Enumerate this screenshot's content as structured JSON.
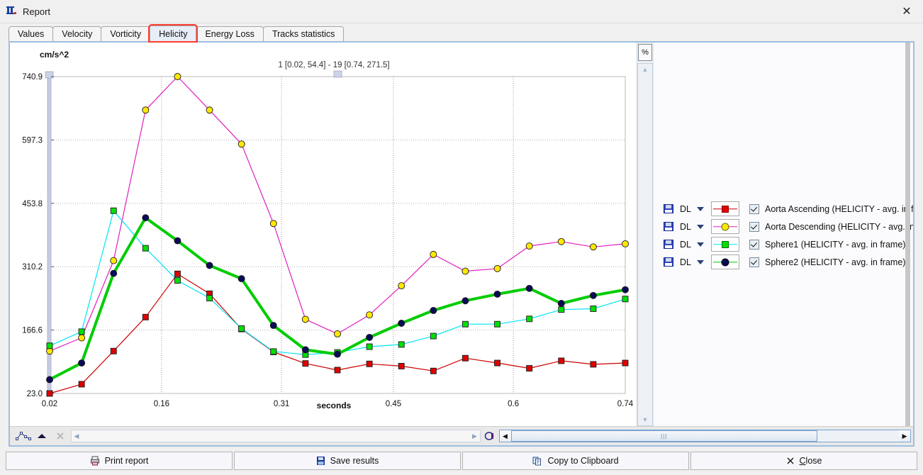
{
  "window": {
    "title": "Report",
    "icon": "report-chart-icon",
    "close_label": "✕"
  },
  "tabs": [
    {
      "label": "Values",
      "active": false,
      "highlight": false
    },
    {
      "label": "Velocity",
      "active": false,
      "highlight": false
    },
    {
      "label": "Vorticity",
      "active": false,
      "highlight": false
    },
    {
      "label": "Helicity",
      "active": true,
      "highlight": true
    },
    {
      "label": "Energy Loss",
      "active": false,
      "highlight": false
    },
    {
      "label": "Tracks statistics",
      "active": false,
      "highlight": false
    }
  ],
  "chart_panel": {
    "unit_label": "cm/s^2",
    "range_label": "1 [0.02, 54.4] - 19 [0.74, 271.5]",
    "percent_button": "%",
    "scroll_up": "▲",
    "scroll_down": "▼",
    "left_arrow": "◀",
    "right_arrow": "▶"
  },
  "toolbar": {
    "line_chart_icon": "line-chart-icon",
    "area_icon": "area-chart-icon",
    "delete_icon": "delete-icon",
    "camera_icon": "snapshot-icon"
  },
  "legend": {
    "dl_label": "DL",
    "items": [
      {
        "dl": "DL",
        "label": "Aorta Ascending (HELICITY  - avg. in fram",
        "color": "#cc0000",
        "marker": "square",
        "marker_fill": "#e00000",
        "checked": true
      },
      {
        "dl": "DL",
        "label": "Aorta Descending (HELICITY  - avg. in fra",
        "color": "#e020c0",
        "marker": "circle",
        "marker_fill": "#ffe800",
        "checked": true
      },
      {
        "dl": "DL",
        "label": "Sphere1 (HELICITY  - avg. in frame)",
        "color": "#00e5f5",
        "marker": "square",
        "marker_fill": "#00e000",
        "checked": true
      },
      {
        "dl": "DL",
        "label": "Sphere2 (HELICITY  - avg. in frame)",
        "color": "#00cc00",
        "marker": "circle",
        "marker_fill": "#0a0a5a",
        "checked": true
      }
    ]
  },
  "footer": {
    "print_label": "Print report",
    "save_label": "Save results",
    "copy_label": "Copy to Clipboard",
    "close_label": "Close"
  },
  "chart_data": {
    "type": "line",
    "title": "1 [0.02, 54.4] - 19 [0.74, 271.5]",
    "xlabel": "seconds",
    "ylabel": "cm/s^2",
    "xlim": [
      0.02,
      0.74
    ],
    "ylim": [
      23.0,
      740.9
    ],
    "xticks": [
      0.02,
      0.16,
      0.31,
      0.45,
      0.6,
      0.74
    ],
    "xtick_labels": [
      "0.02",
      "0.16",
      "0.31",
      "0.45",
      "0.6",
      "0.74"
    ],
    "yticks": [
      23.0,
      166.6,
      310.2,
      453.8,
      597.3,
      740.9
    ],
    "ytick_labels": [
      "23.0",
      "166.6",
      "310.2",
      "453.8",
      "597.3",
      "740.9"
    ],
    "grid": true,
    "legend_position": "right",
    "x": [
      0.02,
      0.06,
      0.1,
      0.14,
      0.18,
      0.22,
      0.26,
      0.3,
      0.34,
      0.38,
      0.42,
      0.46,
      0.5,
      0.54,
      0.58,
      0.62,
      0.66,
      0.7,
      0.74
    ],
    "series": [
      {
        "name": "Aorta Ascending (HELICITY  - avg. in frame)",
        "color": "#cc0000",
        "marker": "square",
        "marker_fill": "#e00000",
        "values": [
          23.0,
          44.0,
          119.0,
          196.0,
          294.0,
          249.0,
          169.0,
          117.0,
          91.0,
          76.0,
          90.0,
          85.0,
          74.0,
          103.0,
          92.0,
          80.0,
          97.0,
          89.0,
          92.0
        ]
      },
      {
        "name": "Aorta Descending (HELICITY  - avg. in frame)",
        "color": "#e020c0",
        "marker": "circle",
        "marker_fill": "#ffe800",
        "values": [
          119.0,
          149.0,
          324.0,
          665.0,
          740.9,
          665.0,
          588.0,
          408.0,
          191.0,
          158.0,
          201.0,
          267.0,
          338.0,
          300.0,
          306.0,
          357.0,
          367.0,
          355.0,
          362.0
        ]
      },
      {
        "name": "Sphere1 (HELICITY  - avg. in frame)",
        "color": "#00e5f5",
        "marker": "square",
        "marker_fill": "#00e000",
        "values": [
          131.0,
          163.0,
          437.0,
          352.0,
          279.0,
          239.0,
          170.0,
          118.0,
          111.0,
          116.0,
          129.0,
          134.0,
          153.0,
          180.0,
          180.0,
          192.0,
          213.0,
          215.0,
          237.0
        ]
      },
      {
        "name": "Sphere2 (HELICITY  - avg. in frame)",
        "color": "#00cc00",
        "marker": "circle",
        "marker_fill": "#0a0a5a",
        "values": [
          54.4,
          92.0,
          295.0,
          421.0,
          369.0,
          313.0,
          283.0,
          177.0,
          122.0,
          112.0,
          150.0,
          182.0,
          211.0,
          233.0,
          248.0,
          261.0,
          227.0,
          245.0,
          258.0
        ]
      }
    ]
  }
}
